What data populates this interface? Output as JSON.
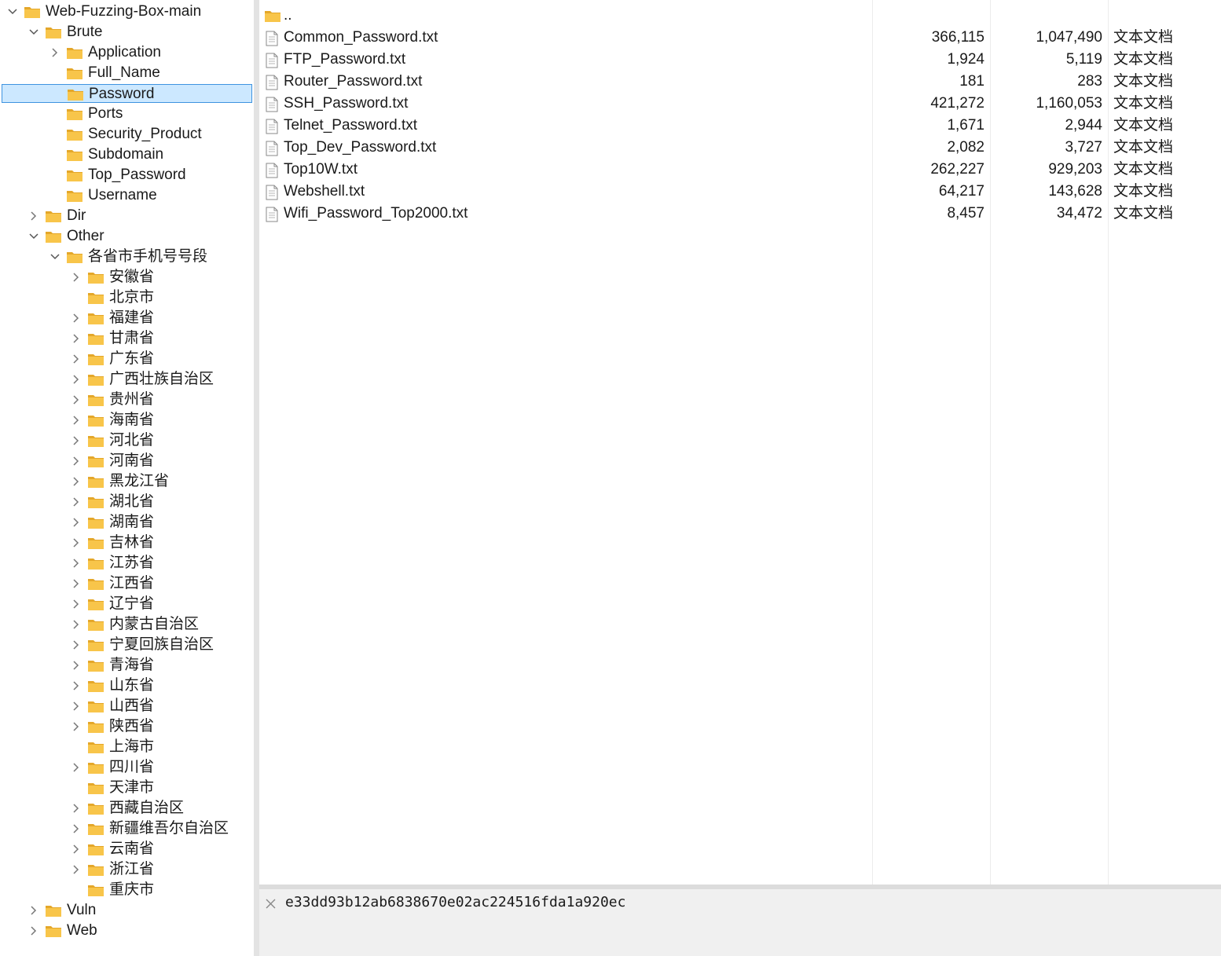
{
  "tree": [
    {
      "label": "Web-Fuzzing-Box-main",
      "level": 0,
      "chevron": "down"
    },
    {
      "label": "Brute",
      "level": 1,
      "chevron": "down"
    },
    {
      "label": "Application",
      "level": 2,
      "chevron": "right"
    },
    {
      "label": "Full_Name",
      "level": 2,
      "chevron": ""
    },
    {
      "label": "Password",
      "level": 2,
      "chevron": "",
      "selected": true
    },
    {
      "label": "Ports",
      "level": 2,
      "chevron": ""
    },
    {
      "label": "Security_Product",
      "level": 2,
      "chevron": ""
    },
    {
      "label": "Subdomain",
      "level": 2,
      "chevron": ""
    },
    {
      "label": "Top_Password",
      "level": 2,
      "chevron": ""
    },
    {
      "label": "Username",
      "level": 2,
      "chevron": ""
    },
    {
      "label": "Dir",
      "level": 1,
      "chevron": "right"
    },
    {
      "label": "Other",
      "level": 1,
      "chevron": "down"
    },
    {
      "label": "各省市手机号号段",
      "level": 2,
      "chevron": "down"
    },
    {
      "label": "安徽省",
      "level": 3,
      "chevron": "right"
    },
    {
      "label": "北京市",
      "level": 3,
      "chevron": ""
    },
    {
      "label": "福建省",
      "level": 3,
      "chevron": "right"
    },
    {
      "label": "甘肃省",
      "level": 3,
      "chevron": "right"
    },
    {
      "label": "广东省",
      "level": 3,
      "chevron": "right"
    },
    {
      "label": "广西壮族自治区",
      "level": 3,
      "chevron": "right"
    },
    {
      "label": "贵州省",
      "level": 3,
      "chevron": "right"
    },
    {
      "label": "海南省",
      "level": 3,
      "chevron": "right"
    },
    {
      "label": "河北省",
      "level": 3,
      "chevron": "right"
    },
    {
      "label": "河南省",
      "level": 3,
      "chevron": "right"
    },
    {
      "label": "黑龙江省",
      "level": 3,
      "chevron": "right"
    },
    {
      "label": "湖北省",
      "level": 3,
      "chevron": "right"
    },
    {
      "label": "湖南省",
      "level": 3,
      "chevron": "right"
    },
    {
      "label": "吉林省",
      "level": 3,
      "chevron": "right"
    },
    {
      "label": "江苏省",
      "level": 3,
      "chevron": "right"
    },
    {
      "label": "江西省",
      "level": 3,
      "chevron": "right"
    },
    {
      "label": "辽宁省",
      "level": 3,
      "chevron": "right"
    },
    {
      "label": "内蒙古自治区",
      "level": 3,
      "chevron": "right"
    },
    {
      "label": "宁夏回族自治区",
      "level": 3,
      "chevron": "right"
    },
    {
      "label": "青海省",
      "level": 3,
      "chevron": "right"
    },
    {
      "label": "山东省",
      "level": 3,
      "chevron": "right"
    },
    {
      "label": "山西省",
      "level": 3,
      "chevron": "right"
    },
    {
      "label": "陕西省",
      "level": 3,
      "chevron": "right"
    },
    {
      "label": "上海市",
      "level": 3,
      "chevron": ""
    },
    {
      "label": "四川省",
      "level": 3,
      "chevron": "right"
    },
    {
      "label": "天津市",
      "level": 3,
      "chevron": ""
    },
    {
      "label": "西藏自治区",
      "level": 3,
      "chevron": "right"
    },
    {
      "label": "新疆维吾尔自治区",
      "level": 3,
      "chevron": "right"
    },
    {
      "label": "云南省",
      "level": 3,
      "chevron": "right"
    },
    {
      "label": "浙江省",
      "level": 3,
      "chevron": "right"
    },
    {
      "label": "重庆市",
      "level": 3,
      "chevron": ""
    },
    {
      "label": "Vuln",
      "level": 1,
      "chevron": "right"
    },
    {
      "label": "Web",
      "level": 1,
      "chevron": "right"
    }
  ],
  "parent_entry": {
    "name": ".."
  },
  "files": [
    {
      "name": "Common_Password.txt",
      "col1": "366,115",
      "col2": "1,047,490",
      "type": "文本文档"
    },
    {
      "name": "FTP_Password.txt",
      "col1": "1,924",
      "col2": "5,119",
      "type": "文本文档"
    },
    {
      "name": "Router_Password.txt",
      "col1": "181",
      "col2": "283",
      "type": "文本文档"
    },
    {
      "name": "SSH_Password.txt",
      "col1": "421,272",
      "col2": "1,160,053",
      "type": "文本文档"
    },
    {
      "name": "Telnet_Password.txt",
      "col1": "1,671",
      "col2": "2,944",
      "type": "文本文档"
    },
    {
      "name": "Top_Dev_Password.txt",
      "col1": "2,082",
      "col2": "3,727",
      "type": "文本文档"
    },
    {
      "name": "Top10W.txt",
      "col1": "262,227",
      "col2": "929,203",
      "type": "文本文档"
    },
    {
      "name": "Webshell.txt",
      "col1": "64,217",
      "col2": "143,628",
      "type": "文本文档"
    },
    {
      "name": "Wifi_Password_Top2000.txt",
      "col1": "8,457",
      "col2": "34,472",
      "type": "文本文档"
    }
  ],
  "bottom": {
    "hash": "e33dd93b12ab6838670e02ac224516fda1a920ec",
    "close_icon": "close-icon"
  },
  "colors": {
    "selection_bg": "#cce8ff",
    "selection_border": "#3f93e0",
    "folder": "#f8c54a",
    "folder_dark": "#e4a72a"
  }
}
